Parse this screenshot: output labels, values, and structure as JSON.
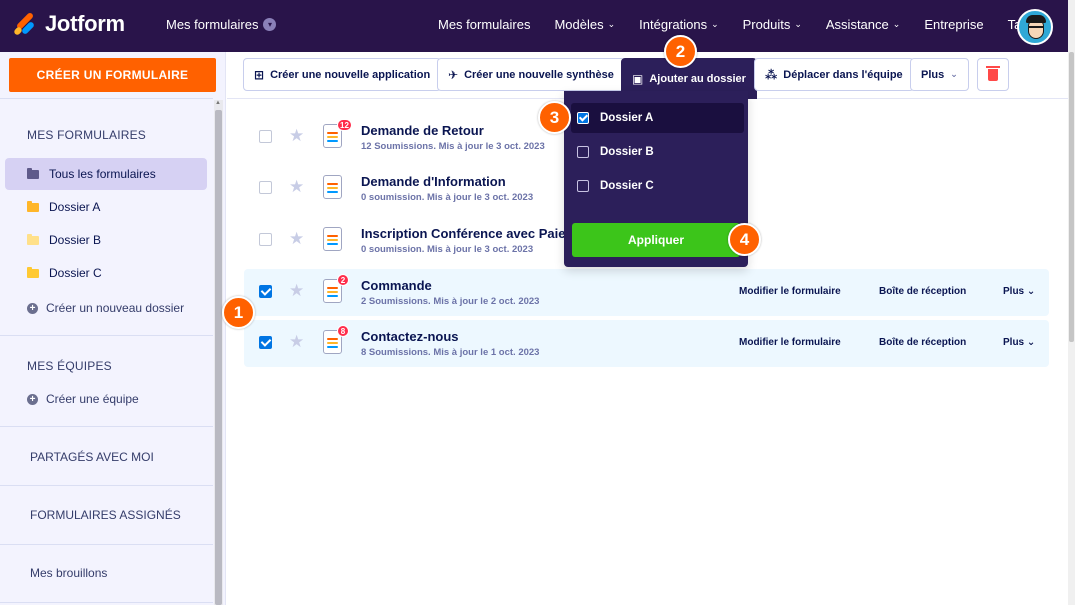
{
  "nav": {
    "logo_text": "Jotform",
    "my_forms": "Mes formulaires",
    "links": [
      {
        "label": "Mes formulaires",
        "caret": false
      },
      {
        "label": "Modèles",
        "caret": true
      },
      {
        "label": "Intégrations",
        "caret": true
      },
      {
        "label": "Produits",
        "caret": true
      },
      {
        "label": "Assistance",
        "caret": true
      },
      {
        "label": "Entreprise",
        "caret": false
      },
      {
        "label": "Tarifs",
        "caret": false
      }
    ]
  },
  "sidebar": {
    "create_button": "CRÉER UN FORMULAIRE",
    "my_forms_heading": "MES FORMULAIRES",
    "items": [
      {
        "label": "Tous les formulaires",
        "folder_color": "#5f5a8a",
        "active": true
      },
      {
        "label": "Dossier A",
        "folder_color": "#ffb629",
        "active": false
      },
      {
        "label": "Dossier B",
        "folder_color": "#ffe08a",
        "active": false
      },
      {
        "label": "Dossier C",
        "folder_color": "#ffc933",
        "active": false
      }
    ],
    "new_folder": "Créer un nouveau dossier",
    "teams_heading": "MES ÉQUIPES",
    "create_team": "Créer une équipe",
    "shared": "PARTAGÉS AVEC MOI",
    "assigned": "FORMULAIRES ASSIGNÉS",
    "drafts": "Mes brouillons"
  },
  "toolbar": {
    "new_app": "Créer une nouvelle application",
    "new_report": "Créer une nouvelle synthèse",
    "add_to_folder": "Ajouter au dossier",
    "move_team": "Déplacer dans l'équipe",
    "more": "Plus"
  },
  "forms": [
    {
      "title": "Demande de Retour",
      "subtitle": "12 Soumissions. Mis à jour le 3 oct. 2023",
      "badge": "12",
      "checked": false,
      "show_actions": false
    },
    {
      "title": "Demande d'Information",
      "subtitle": "0 soumission. Mis à jour le 3 oct. 2023",
      "badge": "",
      "checked": false,
      "show_actions": false
    },
    {
      "title": "Inscription Conférence avec Paie",
      "subtitle": "0 soumission. Mis à jour le 3 oct. 2023",
      "badge": "",
      "checked": false,
      "show_actions": false
    },
    {
      "title": "Commande",
      "subtitle": "2 Soumissions. Mis à jour le 2 oct. 2023",
      "badge": "2",
      "checked": true,
      "show_actions": true
    },
    {
      "title": "Contactez-nous",
      "subtitle": "8 Soumissions. Mis à jour le 1 oct. 2023",
      "badge": "8",
      "checked": true,
      "show_actions": true
    }
  ],
  "row_actions": {
    "edit": "Modifier le formulaire",
    "inbox": "Boîte de réception",
    "more": "Plus"
  },
  "dropdown": {
    "folders": [
      {
        "label": "Dossier A",
        "checked": true
      },
      {
        "label": "Dossier B",
        "checked": false
      },
      {
        "label": "Dossier C",
        "checked": false
      }
    ],
    "apply": "Appliquer"
  },
  "steps": [
    "1",
    "2",
    "3",
    "4"
  ],
  "colors": {
    "nav_bg": "#29144a",
    "accent_orange": "#ff6100",
    "apply_green": "#3cc51a",
    "checkbox_blue": "#0075e3"
  }
}
